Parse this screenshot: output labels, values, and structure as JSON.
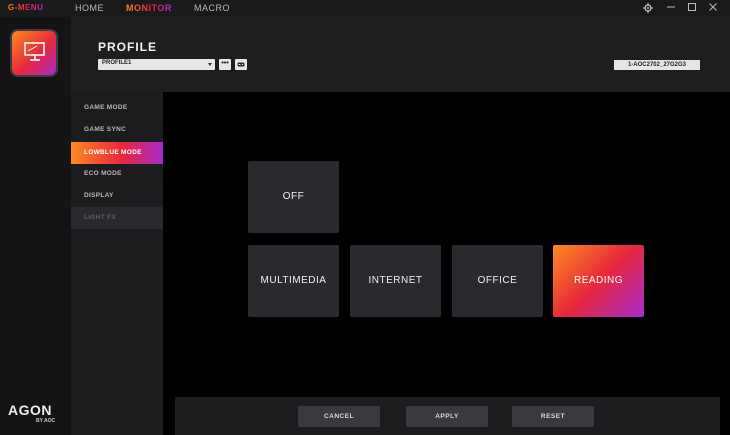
{
  "topbar": {
    "brand": "G-MENU",
    "nav": [
      {
        "label": "HOME",
        "active": false
      },
      {
        "label": "MONITOR",
        "active": true
      },
      {
        "label": "MACRO",
        "active": false
      }
    ],
    "window_icons": [
      "gear-icon",
      "minimize-icon",
      "maximize-icon",
      "close-icon"
    ]
  },
  "sidebar": {
    "logo": "AGON",
    "logo_sub": "BY AOC"
  },
  "profile": {
    "title": "PROFILE",
    "selected": "PROFILE1",
    "more_label": "•••",
    "monitor_id": "1-AOC2702_27G2G3"
  },
  "submenu": {
    "items": [
      {
        "label": "GAME MODE",
        "state": "normal"
      },
      {
        "label": "GAME SYNC",
        "state": "normal"
      },
      {
        "label": "LOWBLUE MODE",
        "state": "active"
      },
      {
        "label": "ECO MODE",
        "state": "normal"
      },
      {
        "label": "DISPLAY",
        "state": "normal"
      },
      {
        "label": "LIGHT FX",
        "state": "disabled"
      }
    ]
  },
  "modes": {
    "off": "OFF",
    "multimedia": "MULTIMEDIA",
    "internet": "INTERNET",
    "office": "OFFICE",
    "reading": "READING",
    "selected": "READING"
  },
  "footer": {
    "cancel": "CANCEL",
    "apply": "APPLY",
    "reset": "RESET"
  },
  "colors": {
    "accent_start": "#ff8a1f",
    "accent_mid": "#e7283a",
    "accent_end": "#a72ad0",
    "card_bg": "#2a2a2e"
  }
}
